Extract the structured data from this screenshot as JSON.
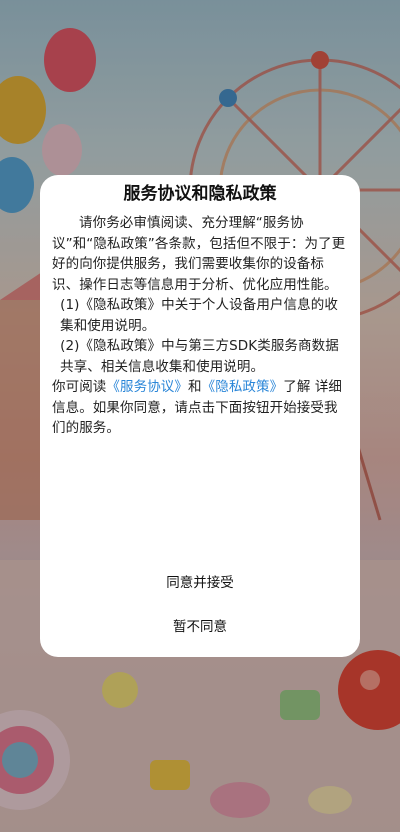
{
  "dialog": {
    "title": "服务协议和隐私政策",
    "intro": "请你务必审慎阅读、充分理解“服务协议”和“隐私政策”各条款，包括但不限于：为了更好的向你提供服务，我们需要收集你的设备标识、操作日志等信息用于分析、优化应用性能。",
    "item1": "(1)《隐私政策》中关于个人设备用户信息的收集和使用说明。",
    "item2": "(2)《隐私政策》中与第三方SDK类服务商数据 共享、相关信息收集和使用说明。",
    "closing_prefix": "你可阅读",
    "link_service": "《服务协议》",
    "closing_and": "和",
    "link_privacy": "《隐私政策》",
    "closing_suffix": "了解 详细信息。如果你同意，请点击下面按钮开始接受我们的服务。",
    "agree_button": "同意并接受",
    "disagree_button": "暂不同意"
  },
  "colors": {
    "link": "#2a86d8",
    "dialog_bg": "#ffffff"
  }
}
